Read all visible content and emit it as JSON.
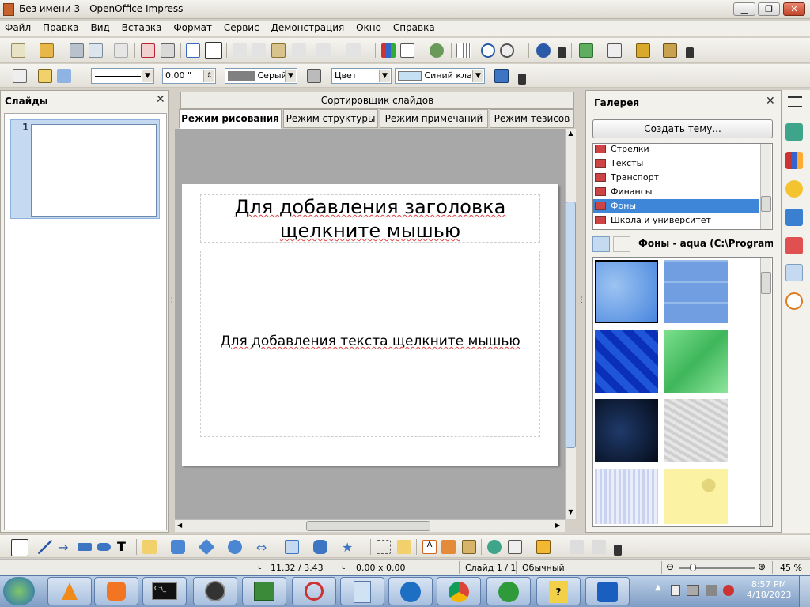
{
  "window": {
    "title": "Без имени 3 - OpenOffice Impress",
    "min": "0",
    "max": "1",
    "close": "r"
  },
  "menu": [
    "Файл",
    "Правка",
    "Вид",
    "Вставка",
    "Формат",
    "Сервис",
    "Демонстрация",
    "Окно",
    "Справка"
  ],
  "line_toolbar": {
    "width_value": "0.00 \"",
    "line_color": "Серый",
    "area_type": "Цвет",
    "area_color": "Синий кла"
  },
  "slides_panel": {
    "title": "Слайды",
    "slide_number": "1"
  },
  "view_tabs": {
    "sorter": "Сортировщик слайдов",
    "tabs": [
      "Режим рисования",
      "Режим структуры",
      "Режим примечаний",
      "Режим тезисов"
    ],
    "active_index": 0
  },
  "slide": {
    "title_line1": "Для добавления заголовка",
    "title_line2": "щелкните мышью",
    "body": "Для добавления текста щелкните мышью"
  },
  "gallery": {
    "title": "Галерея",
    "create_theme": "Создать тему...",
    "themes": [
      "Стрелки",
      "Тексты",
      "Транспорт",
      "Финансы",
      "Фоны",
      "Школа и университет"
    ],
    "selected": "Фоны",
    "current_item": "Фоны - aqua (C:\\Program Files"
  },
  "status": {
    "position": "11.32 / 3.43",
    "size": "0.00 x 0.00",
    "slide": "Слайд 1 / 1",
    "layout": "Обычный",
    "zoom": "45 %"
  },
  "taskbar": {
    "time": "8:57 PM",
    "date": "4/18/2023"
  },
  "colors": {
    "selection": "#3d86d8",
    "canvas_bg": "#a8a8a8",
    "accent_gray": "#808080",
    "area_blue": "#c5dff3"
  }
}
